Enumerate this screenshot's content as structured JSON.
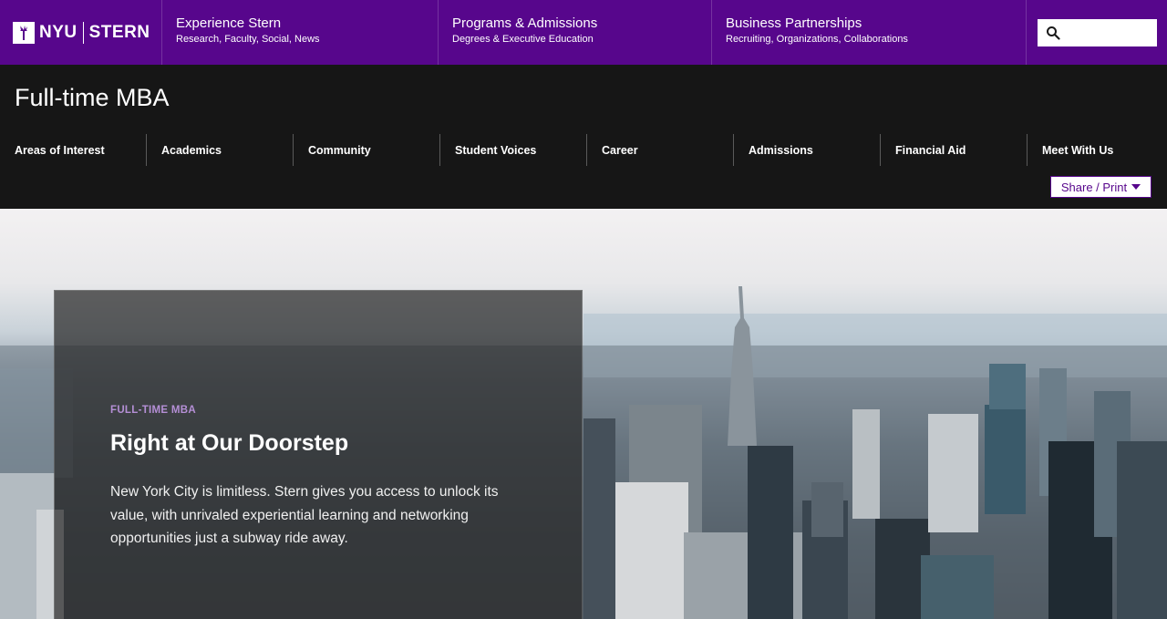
{
  "brand": {
    "left": "NYU",
    "right": "STERN"
  },
  "topnav": [
    {
      "title": "Experience Stern",
      "subtitle": "Research, Faculty, Social, News"
    },
    {
      "title": "Programs & Admissions",
      "subtitle": "Degrees & Executive Education"
    },
    {
      "title": "Business Partnerships",
      "subtitle": "Recruiting, Organizations, Collaborations"
    }
  ],
  "header": {
    "title": "Full-time MBA"
  },
  "secnav": [
    "Areas of Interest",
    "Academics",
    "Community",
    "Student Voices",
    "Career",
    "Admissions",
    "Financial Aid",
    "Meet With Us"
  ],
  "share": {
    "label": "Share / Print"
  },
  "hero": {
    "eyebrow": "FULL-TIME MBA",
    "title": "Right at Our Doorstep",
    "body": "New York City is limitless. Stern gives you access to unlock its value, with unrivaled experiential learning and networking opportunities just a subway ride away."
  },
  "colors": {
    "brand_purple": "#57068c",
    "header_black": "#161616",
    "eyebrow_purple": "#b58fd6"
  },
  "icons": {
    "search": "search-icon",
    "logo": "torch-icon",
    "share_caret": "caret-down-icon"
  }
}
